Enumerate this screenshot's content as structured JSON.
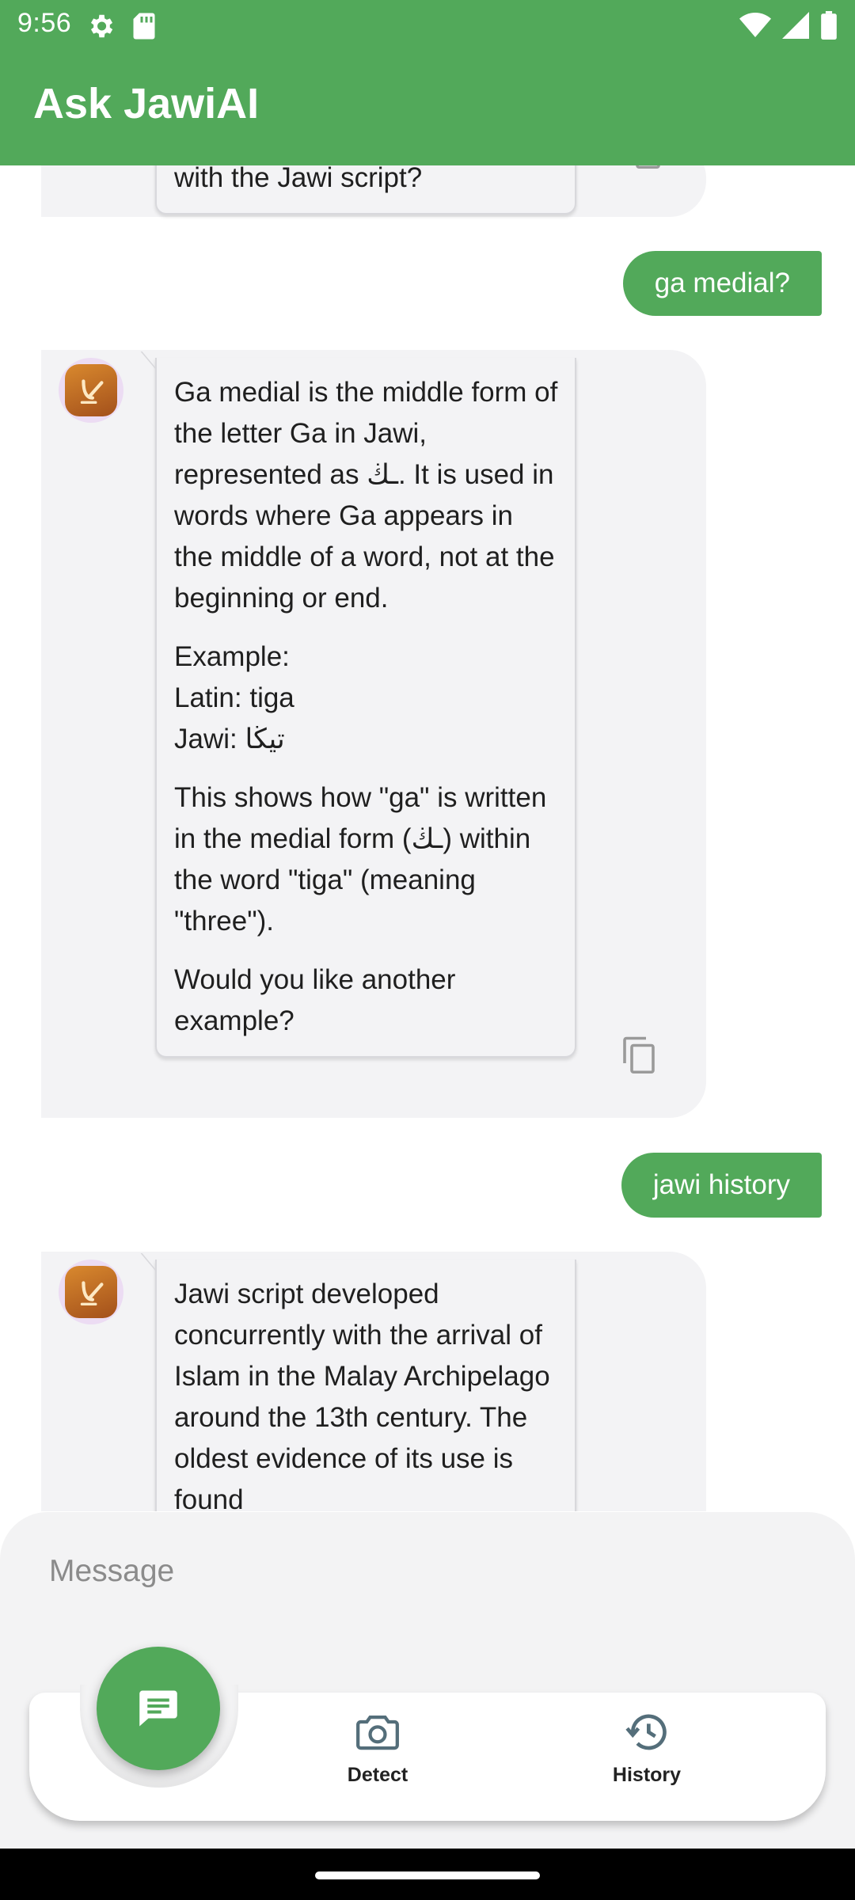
{
  "status_bar": {
    "time": "9:56"
  },
  "app_bar": {
    "title": "Ask JawiAI"
  },
  "chat": {
    "messages": [
      {
        "role": "bot",
        "paragraphs": [
          "with the Jawi script?"
        ]
      },
      {
        "role": "user",
        "text": "ga medial?"
      },
      {
        "role": "bot",
        "paragraphs": [
          "Ga medial is the middle form of the letter Ga in Jawi, represented as ـڬ. It is used in words where Ga appears in the middle of a word, not at the beginning or end.",
          "Example:",
          "Latin: tiga",
          "Jawi: تيڬا",
          "This shows how \"ga\" is written in the medial form (ـڬ) within the word \"tiga\" (meaning \"three\").",
          "Would you like another example?"
        ]
      },
      {
        "role": "user",
        "text": "jawi history"
      },
      {
        "role": "bot",
        "paragraphs": [
          "Jawi script developed concurrently with the arrival of Islam in the Malay Archipelago around the 13th century. The oldest evidence of its use is found"
        ]
      }
    ]
  },
  "composer": {
    "placeholder": "Message"
  },
  "bottom_nav": {
    "items": [
      {
        "label": "Detect",
        "icon": "camera-icon"
      },
      {
        "label": "History",
        "icon": "history-icon"
      }
    ],
    "fab_icon": "chat-bubble-icon"
  },
  "colors": {
    "primary": "#52a95a",
    "bot_bubble": "#f3f3f5",
    "composer_bg": "#f3f3f4"
  }
}
